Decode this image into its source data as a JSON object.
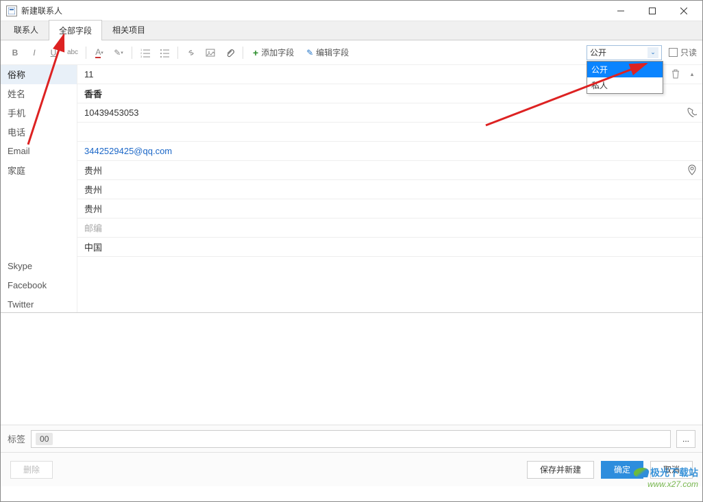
{
  "titlebar": {
    "icon_label": "⛶",
    "title": "新建联系人"
  },
  "tabs": {
    "contact": "联系人",
    "all_fields": "全部字段",
    "related": "相关项目"
  },
  "toolbar": {
    "add_field": "添加字段",
    "edit_field": "编辑字段",
    "privacy_selected": "公开",
    "privacy_options": {
      "public": "公开",
      "private": "私人"
    },
    "readonly_label": "只读"
  },
  "fields": {
    "nickname": {
      "label": "俗称",
      "value": "11"
    },
    "name": {
      "label": "姓名",
      "value": "香香"
    },
    "mobile": {
      "label": "手机",
      "value": "10439453053"
    },
    "phone": {
      "label": "电话",
      "value": ""
    },
    "email": {
      "label": "Email",
      "value": "3442529425@qq.com"
    },
    "home": {
      "label": "家庭",
      "addr1": "贵州",
      "addr2": "贵州",
      "addr3": "贵州",
      "postal_placeholder": "邮编",
      "country": "中国"
    },
    "skype": {
      "label": "Skype",
      "value": ""
    },
    "facebook": {
      "label": "Facebook",
      "value": ""
    },
    "twitter": {
      "label": "Twitter",
      "value": ""
    }
  },
  "tags": {
    "label": "标签",
    "chip": "00"
  },
  "footer": {
    "delete": "删除",
    "save_and_new": "保存并新建",
    "ok": "确定",
    "cancel": "取消"
  },
  "watermark": {
    "cn": "极光下载站",
    "url": "www.x27.com"
  }
}
